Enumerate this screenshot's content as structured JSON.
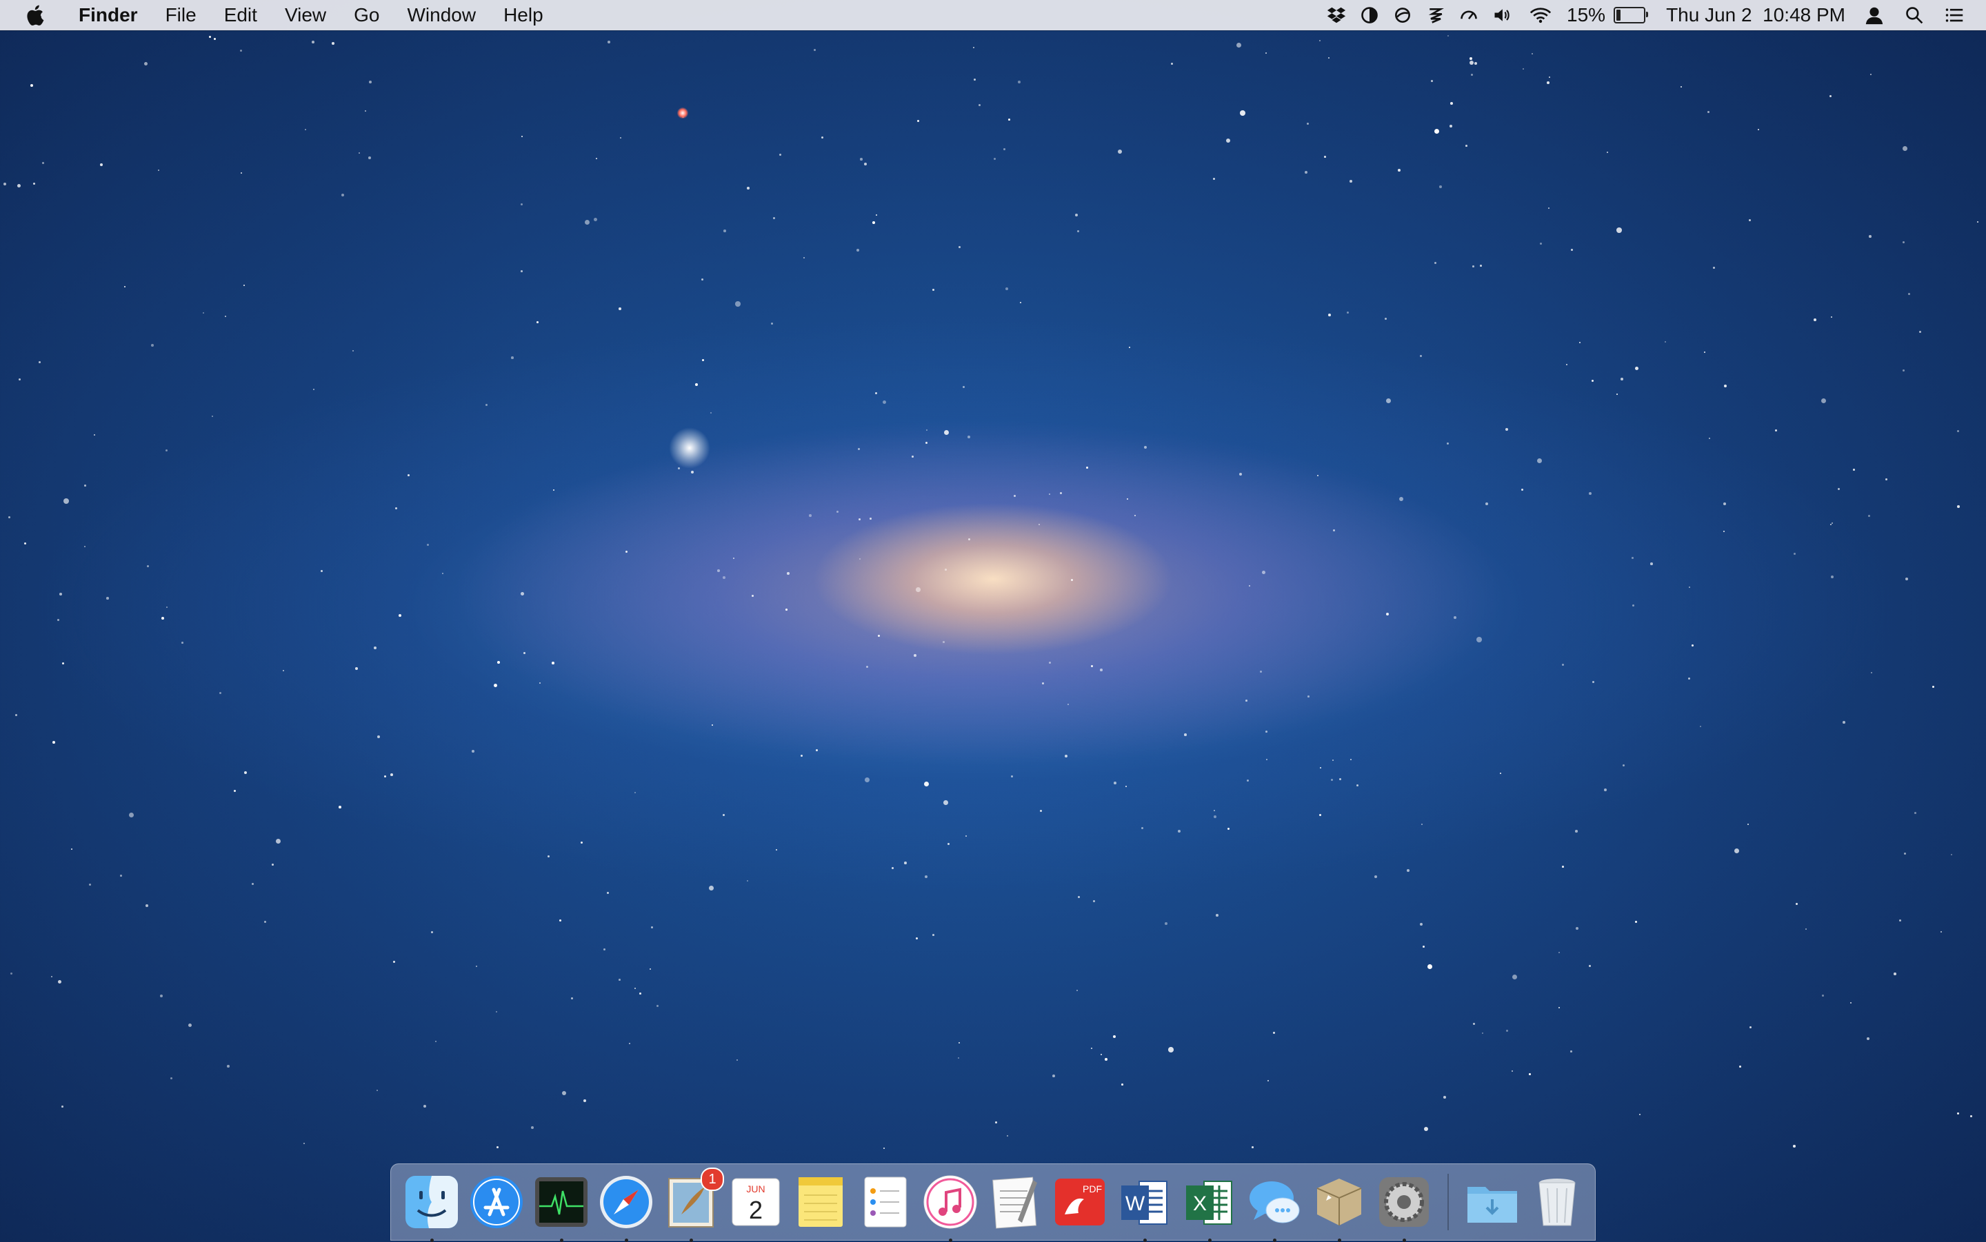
{
  "menubar": {
    "app_name": "Finder",
    "menus": [
      "File",
      "Edit",
      "View",
      "Go",
      "Window",
      "Help"
    ],
    "battery_percent": "15%",
    "battery_level": 0.15,
    "datetime": "Thu Jun 2  10:48 PM",
    "status_icons": [
      "dropbox-icon",
      "contrast-icon",
      "circle-slash-icon",
      "bolt-stack-icon",
      "speedometer-icon",
      "volume-icon",
      "wifi-icon"
    ]
  },
  "dock": {
    "apps": [
      {
        "name": "finder-icon",
        "running": true
      },
      {
        "name": "app-store-icon",
        "running": false
      },
      {
        "name": "activity-monitor-icon",
        "running": true
      },
      {
        "name": "safari-icon",
        "running": true
      },
      {
        "name": "mail-icon",
        "running": true,
        "badge": "1"
      },
      {
        "name": "calendar-icon",
        "running": false,
        "month": "JUN",
        "day": "2"
      },
      {
        "name": "notes-icon",
        "running": false
      },
      {
        "name": "reminders-icon",
        "running": false
      },
      {
        "name": "itunes-icon",
        "running": true
      },
      {
        "name": "textedit-icon",
        "running": false
      },
      {
        "name": "pdf-reader-icon",
        "running": false,
        "label": "PDF"
      },
      {
        "name": "word-icon",
        "running": true,
        "label": "W"
      },
      {
        "name": "excel-icon",
        "running": true,
        "label": "X"
      },
      {
        "name": "messages-icon",
        "running": true
      },
      {
        "name": "package-icon",
        "running": true
      },
      {
        "name": "system-preferences-icon",
        "running": true
      }
    ],
    "stacks": [
      {
        "name": "downloads-folder-icon"
      },
      {
        "name": "trash-icon"
      }
    ]
  },
  "colors": {
    "menubar_bg": "#ECECF0",
    "wallpaper_dark": "#0d2450",
    "wallpaper_mid": "#1f5aa3",
    "badge_red": "#e23b2e"
  }
}
